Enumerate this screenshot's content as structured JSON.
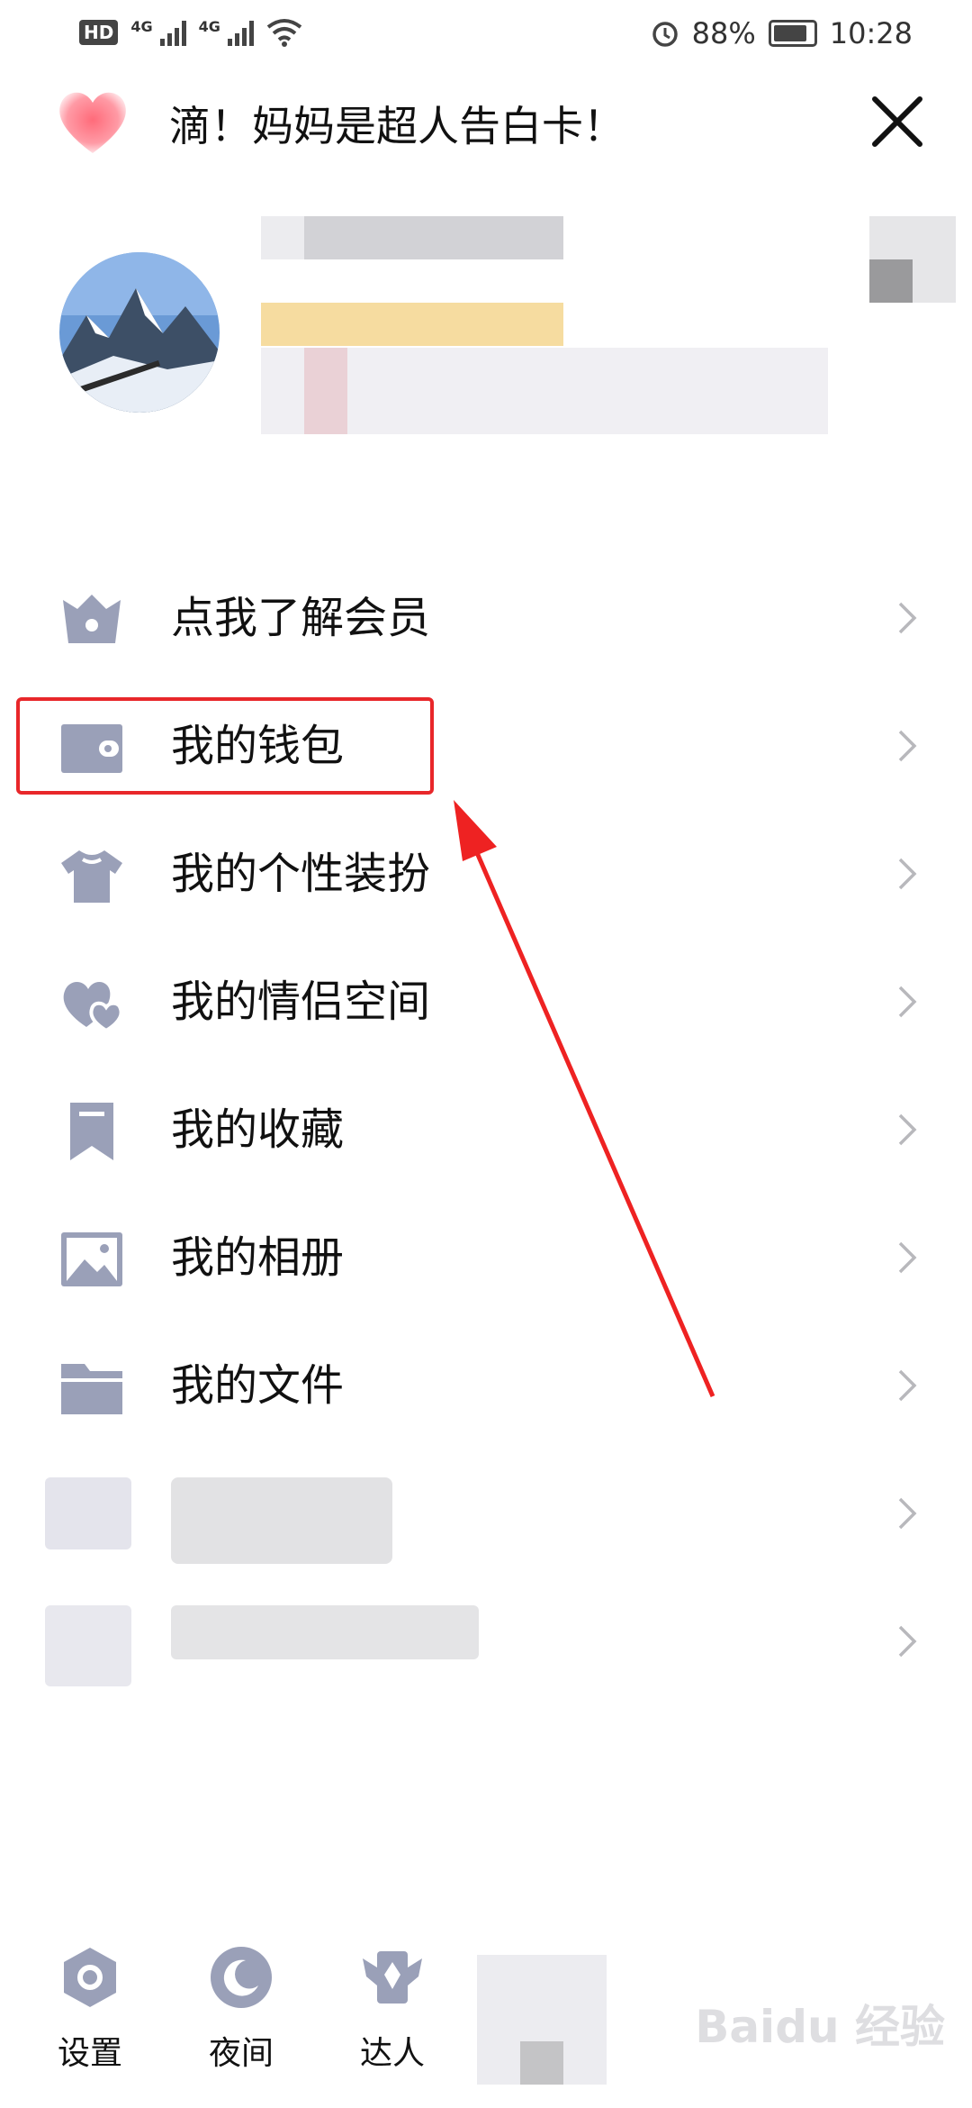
{
  "status_bar": {
    "hd": "HD",
    "net1": "4G",
    "net2": "4G",
    "battery": "88%",
    "time": "10:28"
  },
  "banner": {
    "text": "滴！妈妈是超人告白卡！"
  },
  "menu": {
    "items": [
      {
        "label": "点我了解会员",
        "icon": "crown-icon"
      },
      {
        "label": "我的钱包",
        "icon": "wallet-icon"
      },
      {
        "label": "我的个性装扮",
        "icon": "tshirt-icon"
      },
      {
        "label": "我的情侣空间",
        "icon": "hearts-icon"
      },
      {
        "label": "我的收藏",
        "icon": "bookmark-icon"
      },
      {
        "label": "我的相册",
        "icon": "photo-icon"
      },
      {
        "label": "我的文件",
        "icon": "folder-icon"
      }
    ]
  },
  "bottom_nav": {
    "settings": "设置",
    "night": "夜间",
    "expert": "达人"
  },
  "watermark": "Baidu 经验",
  "colors": {
    "icon": "#9aa0b8",
    "highlight": "#e8272a",
    "chevron": "#b8b8bc"
  }
}
